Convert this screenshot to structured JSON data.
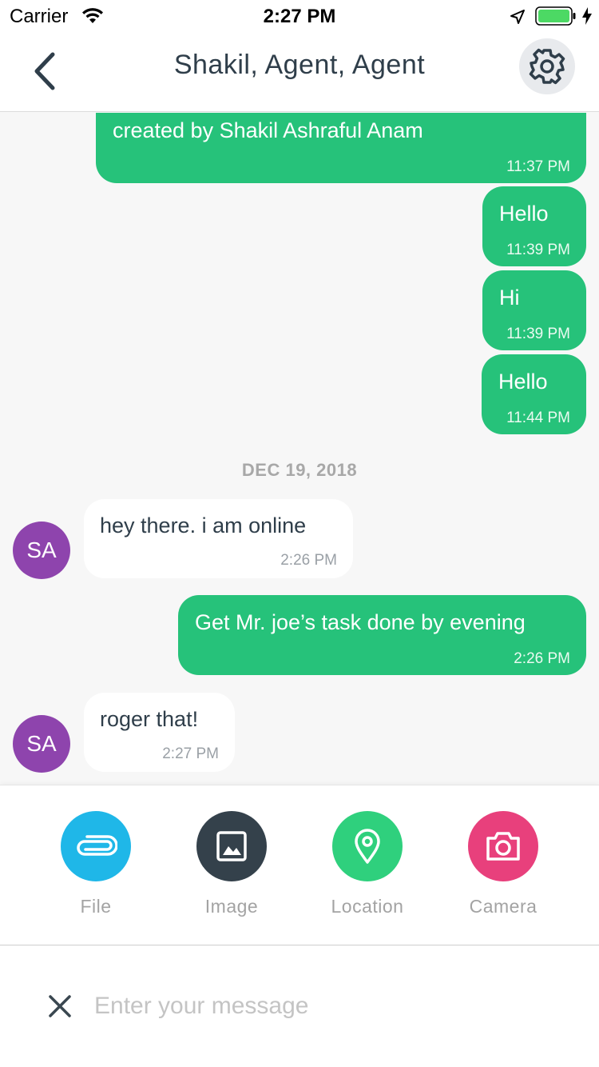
{
  "status_bar": {
    "carrier": "Carrier",
    "time": "2:27 PM"
  },
  "header": {
    "title": "Shakil, Agent, Agent",
    "back_icon": "chevron-left-icon",
    "settings_icon": "gear-icon"
  },
  "colors": {
    "outgoing_bubble": "#26c27a",
    "incoming_bubble": "#ffffff",
    "avatar": "#8e44ad",
    "file": "#1fb7e8",
    "image": "#34414b",
    "location": "#2fd07d",
    "camera": "#e8407c"
  },
  "messages": [
    {
      "direction": "out",
      "text": "created by Shakil Ashraful Anam",
      "time": "11:37 PM"
    },
    {
      "direction": "out",
      "text": "Hello",
      "time": "11:39 PM"
    },
    {
      "direction": "out",
      "text": "Hi",
      "time": "11:39 PM"
    },
    {
      "direction": "out",
      "text": "Hello",
      "time": "11:44 PM"
    },
    {
      "direction": "in",
      "avatar": "SA",
      "text": "hey there. i am online",
      "time": "2:26 PM"
    },
    {
      "direction": "out",
      "text": "Get Mr. joe’s task done by evening",
      "time": "2:26 PM"
    },
    {
      "direction": "in",
      "avatar": "SA",
      "text": "roger that!",
      "time": "2:27 PM"
    }
  ],
  "date_divider": "DEC 19, 2018",
  "attachments": [
    {
      "label": "File",
      "icon": "paperclip-icon"
    },
    {
      "label": "Image",
      "icon": "image-icon"
    },
    {
      "label": "Location",
      "icon": "map-pin-icon"
    },
    {
      "label": "Camera",
      "icon": "camera-icon"
    }
  ],
  "composer": {
    "placeholder": "Enter your message",
    "value": ""
  }
}
